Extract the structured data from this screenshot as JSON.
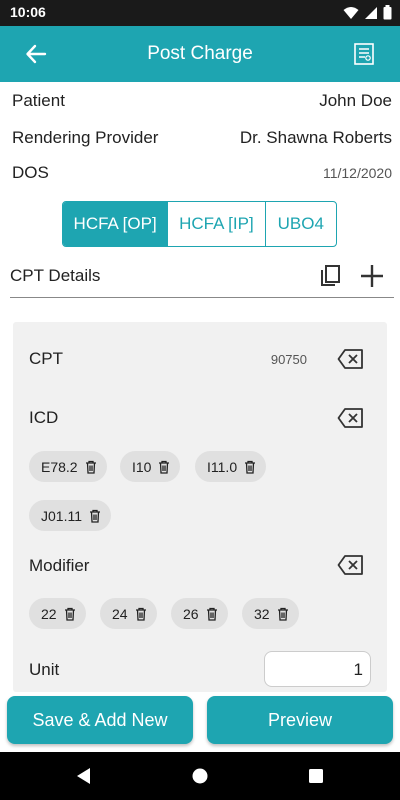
{
  "status_bar": {
    "time": "10:06"
  },
  "app_bar": {
    "title": "Post Charge"
  },
  "info": {
    "patient_label": "Patient",
    "patient_value": "John Doe",
    "provider_label": "Rendering Provider",
    "provider_value": "Dr. Shawna Roberts",
    "dos_label": "DOS",
    "dos_value": "11/12/2020"
  },
  "tabs": [
    {
      "label": "HCFA [OP]",
      "selected": true
    },
    {
      "label": "HCFA [IP]",
      "selected": false
    },
    {
      "label": "UBO4",
      "selected": false
    }
  ],
  "cpt_details": {
    "title": "CPT Details",
    "cpt_label": "CPT",
    "cpt_value": "90750",
    "icd_label": "ICD",
    "icd_codes": [
      "E78.2",
      "I10",
      "I11.0",
      "J01.11"
    ],
    "modifier_label": "Modifier",
    "modifiers": [
      "22",
      "24",
      "26",
      "32"
    ],
    "unit_label": "Unit",
    "unit_value": "1"
  },
  "buttons": {
    "save_add_new": "Save & Add New",
    "preview": "Preview"
  },
  "colors": {
    "accent": "#1ea5b1",
    "status_bar": "#1a1a1a",
    "chip": "#e0e0e0",
    "card": "#f1f1f1"
  }
}
